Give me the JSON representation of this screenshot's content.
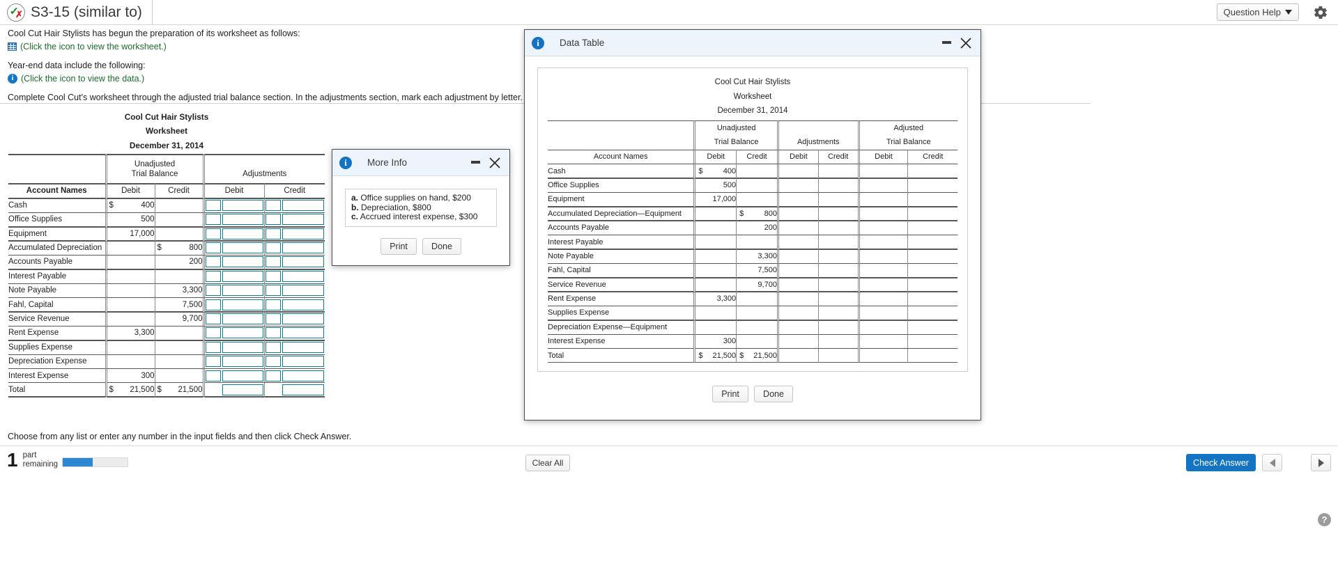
{
  "header": {
    "title": "S3-15 (similar to)",
    "question_help_label": "Question Help",
    "question_help_icon": "chevron-down-icon",
    "settings_icon": "gear-icon",
    "status_icon": "check-x-icon"
  },
  "statement": {
    "line1": "Cool Cut Hair Stylists has begun the preparation of its worksheet as follows:",
    "worksheet_link": "(Click the icon to view the worksheet.)",
    "worksheet_icon": "spreadsheet-icon",
    "line2": "Year-end data include the following:",
    "data_link": "(Click the icon to view the data.)",
    "data_icon": "info-icon",
    "line3": "Complete Cool Cut's worksheet through the adjusted trial balance section. In the adjustments section, mark each adjustment by letter."
  },
  "worksheet": {
    "company": "Cool Cut Hair Stylists",
    "doc_type": "Worksheet",
    "date": "December 31, 2014",
    "groups": [
      {
        "line1": "Unadjusted",
        "line2": "Trial Balance"
      },
      {
        "line1": "",
        "line2": "Adjustments"
      }
    ],
    "columns": [
      "Account Names",
      "Debit",
      "Credit",
      "Debit",
      "Credit"
    ],
    "rows": [
      {
        "name": "Cash",
        "utb_debit_sym": "$",
        "utb_debit": "400",
        "utb_credit_sym": "",
        "utb_credit": ""
      },
      {
        "name": "Office Supplies",
        "utb_debit_sym": "",
        "utb_debit": "500",
        "utb_credit_sym": "",
        "utb_credit": ""
      },
      {
        "name": "Equipment",
        "utb_debit_sym": "",
        "utb_debit": "17,000",
        "utb_credit_sym": "",
        "utb_credit": ""
      },
      {
        "name": "Accumulated Depreciation",
        "utb_debit_sym": "",
        "utb_debit": "",
        "utb_credit_sym": "$",
        "utb_credit": "800"
      },
      {
        "name": "Accounts Payable",
        "utb_debit_sym": "",
        "utb_debit": "",
        "utb_credit_sym": "",
        "utb_credit": "200"
      },
      {
        "name": "Interest Payable",
        "utb_debit_sym": "",
        "utb_debit": "",
        "utb_credit_sym": "",
        "utb_credit": ""
      },
      {
        "name": "Note Payable",
        "utb_debit_sym": "",
        "utb_debit": "",
        "utb_credit_sym": "",
        "utb_credit": "3,300"
      },
      {
        "name": "Fahl, Capital",
        "utb_debit_sym": "",
        "utb_debit": "",
        "utb_credit_sym": "",
        "utb_credit": "7,500"
      },
      {
        "name": "Service Revenue",
        "utb_debit_sym": "",
        "utb_debit": "",
        "utb_credit_sym": "",
        "utb_credit": "9,700"
      },
      {
        "name": "Rent Expense",
        "utb_debit_sym": "",
        "utb_debit": "3,300",
        "utb_credit_sym": "",
        "utb_credit": ""
      },
      {
        "name": "Supplies Expense",
        "utb_debit_sym": "",
        "utb_debit": "",
        "utb_credit_sym": "",
        "utb_credit": ""
      },
      {
        "name": "Depreciation Expense",
        "utb_debit_sym": "",
        "utb_debit": "",
        "utb_credit_sym": "",
        "utb_credit": ""
      },
      {
        "name": "Interest Expense",
        "utb_debit_sym": "",
        "utb_debit": "300",
        "utb_credit_sym": "",
        "utb_credit": ""
      }
    ],
    "total": {
      "name": "Total",
      "utb_debit_sym": "$",
      "utb_debit": "21,500",
      "utb_credit_sym": "$",
      "utb_credit": "21,500"
    }
  },
  "more_info_dialog": {
    "title": "More Info",
    "icon": "info-icon",
    "minimize_icon": "minimize-icon",
    "close_icon": "close-icon",
    "items": [
      {
        "letter": "a.",
        "text": "Office supplies on hand, $200"
      },
      {
        "letter": "b.",
        "text": "Depreciation, $800"
      },
      {
        "letter": "c.",
        "text": "Accrued interest expense, $300"
      }
    ],
    "print_label": "Print",
    "done_label": "Done"
  },
  "data_table_dialog": {
    "title": "Data Table",
    "icon": "info-icon",
    "minimize_icon": "minimize-icon",
    "close_icon": "close-icon",
    "print_label": "Print",
    "done_label": "Done",
    "table": {
      "company": "Cool Cut Hair Stylists",
      "doc_type": "Worksheet",
      "date": "December 31, 2014",
      "groups": [
        {
          "line1": "Unadjusted",
          "line2": "Trial Balance"
        },
        {
          "line1": "",
          "line2": "Adjustments"
        },
        {
          "line1": "Adjusted",
          "line2": "Trial Balance"
        }
      ],
      "columns": [
        "Account Names",
        "Debit",
        "Credit",
        "Debit",
        "Credit",
        "Debit",
        "Credit"
      ],
      "rows": [
        {
          "name": "Cash",
          "d_sym": "$",
          "d": "400",
          "c_sym": "",
          "c": ""
        },
        {
          "name": "Office Supplies",
          "d_sym": "",
          "d": "500",
          "c_sym": "",
          "c": ""
        },
        {
          "name": "Equipment",
          "d_sym": "",
          "d": "17,000",
          "c_sym": "",
          "c": ""
        },
        {
          "name": "Accumulated Depreciation—Equipment",
          "d_sym": "",
          "d": "",
          "c_sym": "$",
          "c": "800"
        },
        {
          "name": "Accounts Payable",
          "d_sym": "",
          "d": "",
          "c_sym": "",
          "c": "200"
        },
        {
          "name": "Interest Payable",
          "d_sym": "",
          "d": "",
          "c_sym": "",
          "c": ""
        },
        {
          "name": "Note Payable",
          "d_sym": "",
          "d": "",
          "c_sym": "",
          "c": "3,300"
        },
        {
          "name": "Fahl, Capital",
          "d_sym": "",
          "d": "",
          "c_sym": "",
          "c": "7,500"
        },
        {
          "name": "Service Revenue",
          "d_sym": "",
          "d": "",
          "c_sym": "",
          "c": "9,700"
        },
        {
          "name": "Rent Expense",
          "d_sym": "",
          "d": "3,300",
          "c_sym": "",
          "c": ""
        },
        {
          "name": "Supplies Expense",
          "d_sym": "",
          "d": "",
          "c_sym": "",
          "c": ""
        },
        {
          "name": "Depreciation Expense—Equipment",
          "d_sym": "",
          "d": "",
          "c_sym": "",
          "c": ""
        },
        {
          "name": "Interest Expense",
          "d_sym": "",
          "d": "300",
          "c_sym": "",
          "c": ""
        }
      ],
      "total": {
        "name": "Total",
        "d_sym": "$",
        "d": "21,500",
        "c_sym": "$",
        "c": "21,500"
      }
    }
  },
  "footer": {
    "part_count": "1",
    "part_label_line1": "part",
    "part_label_line2": "remaining",
    "progress_percent": 46,
    "clear_all_label": "Clear All",
    "instruction": "Choose from any list or enter any number in the input fields and then click Check Answer.",
    "check_answer_label": "Check Answer",
    "prev_icon": "triangle-left-icon",
    "next_icon": "triangle-right-icon",
    "help_label": "?"
  },
  "colors": {
    "accent_blue": "#1474c4",
    "input_border": "#0e7c86",
    "link_green": "#1d6b2e",
    "dialog_header": "#eef4fb"
  }
}
